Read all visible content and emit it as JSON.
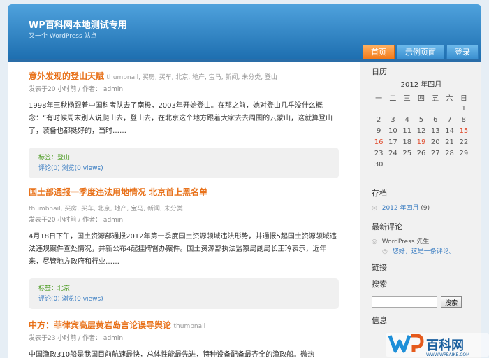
{
  "site": {
    "title": "WP百科网本地测试专用",
    "description": "又一个 WordPress 站点"
  },
  "nav": [
    "首页",
    "示例页面",
    "登录"
  ],
  "posts": [
    {
      "title": "意外发现的登山天赋",
      "tags": "thumbnail, 买房, 买车, 北京, 地产, 宝马, 新闻, 未分类, 登山",
      "meta": "发表于20 小时前 / 作者： admin",
      "body": "1998年王秋杨跟着中国科考队去了南极，2003年开始登山。在那之前，她对登山几乎没什么概念：“有时候周末别人说爬山去，登山去，在北京这个地方跟着大家去去周围的云蒙山，这就算登山了，装备也都挺好的，当时……",
      "tag_line": "标签：登山",
      "comments": "评论(0)",
      "views": "浏览(0 views)"
    },
    {
      "title": "国土部通报一季度违法用地情况 北京首上黑名单",
      "tags": "thumbnail, 买房, 买车, 北京, 地产, 宝马, 新闻, 未分类",
      "meta": "发表于20 小时前 / 作者： admin",
      "body": "4月18日下午，国土资源部通报2012年第一季度国土资源领域违法形势，并通报5起国土资源领域违法违规案件查处情况，并新公布4起挂牌督办案件。国土资源部执法监察局副局长王玲表示，近年来，尽管地方政府和行业……",
      "tag_line": "标签：北京",
      "comments": "评论(0)",
      "views": "浏览(0 views)"
    },
    {
      "title": "中方：菲律宾高层黄岩岛言论误导舆论",
      "tags": "thumbnail",
      "meta": "发表于23 小时前 / 作者： admin",
      "body": "中国渔政310船是我国目前航速最快，总体性能最先进，特种设备配备最齐全的渔政船。微热"
    }
  ],
  "sidebar": {
    "calendar_title": "日历",
    "calendar_caption": "2012 年四月",
    "weekdays": [
      "一",
      "二",
      "三",
      "四",
      "五",
      "六",
      "日"
    ],
    "weeks": [
      [
        "",
        "",
        "",
        "",
        "",
        "",
        "1"
      ],
      [
        "2",
        "3",
        "4",
        "5",
        "6",
        "7",
        "8"
      ],
      [
        "9",
        "10",
        "11",
        "12",
        "13",
        "14",
        "15"
      ],
      [
        "16",
        "17",
        "18",
        "19",
        "20",
        "21",
        "22"
      ],
      [
        "23",
        "24",
        "25",
        "26",
        "27",
        "28",
        "29"
      ],
      [
        "30",
        "",
        "",
        "",
        "",
        "",
        ""
      ]
    ],
    "highlight_days": [
      "15",
      "16",
      "19"
    ],
    "archive_title": "存档",
    "archive_link": "2012 年四月",
    "archive_count": "(9)",
    "comments_title": "最新评论",
    "comment_author": "WordPress 先生",
    "comment_link": "您好，这是一条评论。",
    "links_title": "链接",
    "search_title": "搜索",
    "search_button": "搜索",
    "info_title": "信息"
  },
  "watermark": {
    "text": "百科网",
    "url": "WWW.WPBAIKE.COM"
  },
  "colors": {
    "accent": "#e8721b",
    "header": "#2a7bc0",
    "link": "#3a7dc2"
  }
}
